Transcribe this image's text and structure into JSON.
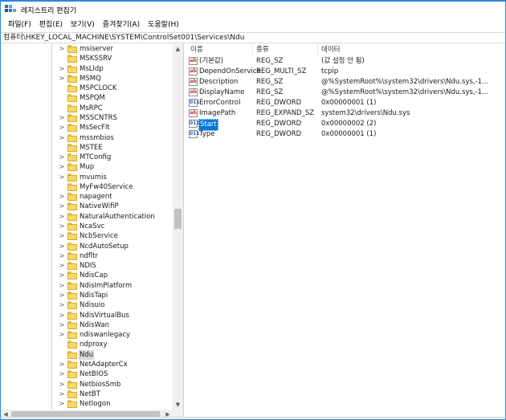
{
  "window": {
    "title": "레지스트리 편집기",
    "icon": "registry-editor-icon"
  },
  "menu": [
    "파일(F)",
    "편집(E)",
    "보기(V)",
    "즐겨찾기(A)",
    "도움말(H)"
  ],
  "address": "컴퓨터\\HKEY_LOCAL_MACHINE\\SYSTEM\\ControlSet001\\Services\\Ndu",
  "tree": {
    "items": [
      {
        "label": "msiserver",
        "expandable": true
      },
      {
        "label": "MSKSSRV",
        "expandable": false
      },
      {
        "label": "MsLldp",
        "expandable": true
      },
      {
        "label": "MSMQ",
        "expandable": true
      },
      {
        "label": "MSPCLOCK",
        "expandable": false
      },
      {
        "label": "MSPQM",
        "expandable": false
      },
      {
        "label": "MsRPC",
        "expandable": false
      },
      {
        "label": "MSSCNTRS",
        "expandable": true
      },
      {
        "label": "MsSecFlt",
        "expandable": true
      },
      {
        "label": "mssmbios",
        "expandable": true
      },
      {
        "label": "MSTEE",
        "expandable": false
      },
      {
        "label": "MTConfig",
        "expandable": true
      },
      {
        "label": "Mup",
        "expandable": true
      },
      {
        "label": "mvumis",
        "expandable": true
      },
      {
        "label": "MyFw40Service",
        "expandable": false
      },
      {
        "label": "napagent",
        "expandable": true
      },
      {
        "label": "NativeWifiP",
        "expandable": true
      },
      {
        "label": "NaturalAuthentication",
        "expandable": true
      },
      {
        "label": "NcaSvc",
        "expandable": true
      },
      {
        "label": "NcbService",
        "expandable": true
      },
      {
        "label": "NcdAutoSetup",
        "expandable": true
      },
      {
        "label": "ndfltr",
        "expandable": true
      },
      {
        "label": "NDIS",
        "expandable": true
      },
      {
        "label": "NdisCap",
        "expandable": true
      },
      {
        "label": "NdisImPlatform",
        "expandable": true
      },
      {
        "label": "NdisTapi",
        "expandable": true
      },
      {
        "label": "Ndisuio",
        "expandable": true
      },
      {
        "label": "NdisVirtualBus",
        "expandable": true
      },
      {
        "label": "NdisWan",
        "expandable": true
      },
      {
        "label": "ndiswanlegacy",
        "expandable": true
      },
      {
        "label": "ndproxy",
        "expandable": false
      },
      {
        "label": "Ndu",
        "expandable": false,
        "selected": true
      },
      {
        "label": "NetAdapterCx",
        "expandable": true
      },
      {
        "label": "NetBIOS",
        "expandable": true
      },
      {
        "label": "NetbiosSmb",
        "expandable": true
      },
      {
        "label": "NetBT",
        "expandable": true
      },
      {
        "label": "Netlogon",
        "expandable": true
      }
    ]
  },
  "values": {
    "columns": {
      "name": "이름",
      "type": "종류",
      "data": "데이터"
    },
    "rows": [
      {
        "name": "(기본값)",
        "type": "REG_SZ",
        "data": "(값 설정 안 됨)",
        "icon": "string-value-icon",
        "kind": "sz"
      },
      {
        "name": "DependOnService",
        "type": "REG_MULTI_SZ",
        "data": "tcpip",
        "icon": "string-value-icon",
        "kind": "sz"
      },
      {
        "name": "Description",
        "type": "REG_SZ",
        "data": "@%SystemRoot%\\system32\\drivers\\Ndu.sys,-1...",
        "icon": "string-value-icon",
        "kind": "sz"
      },
      {
        "name": "DisplayName",
        "type": "REG_SZ",
        "data": "@%SystemRoot%\\system32\\drivers\\Ndu.sys,-1...",
        "icon": "string-value-icon",
        "kind": "sz"
      },
      {
        "name": "ErrorControl",
        "type": "REG_DWORD",
        "data": "0x00000001 (1)",
        "icon": "binary-value-icon",
        "kind": "dw"
      },
      {
        "name": "ImagePath",
        "type": "REG_EXPAND_SZ",
        "data": "system32\\drivers\\Ndu.sys",
        "icon": "string-value-icon",
        "kind": "sz"
      },
      {
        "name": "Start",
        "type": "REG_DWORD",
        "data": "0x00000002 (2)",
        "icon": "binary-value-icon",
        "kind": "dw",
        "selected": true
      },
      {
        "name": "Type",
        "type": "REG_DWORD",
        "data": "0x00000001 (1)",
        "icon": "binary-value-icon",
        "kind": "dw"
      }
    ]
  }
}
